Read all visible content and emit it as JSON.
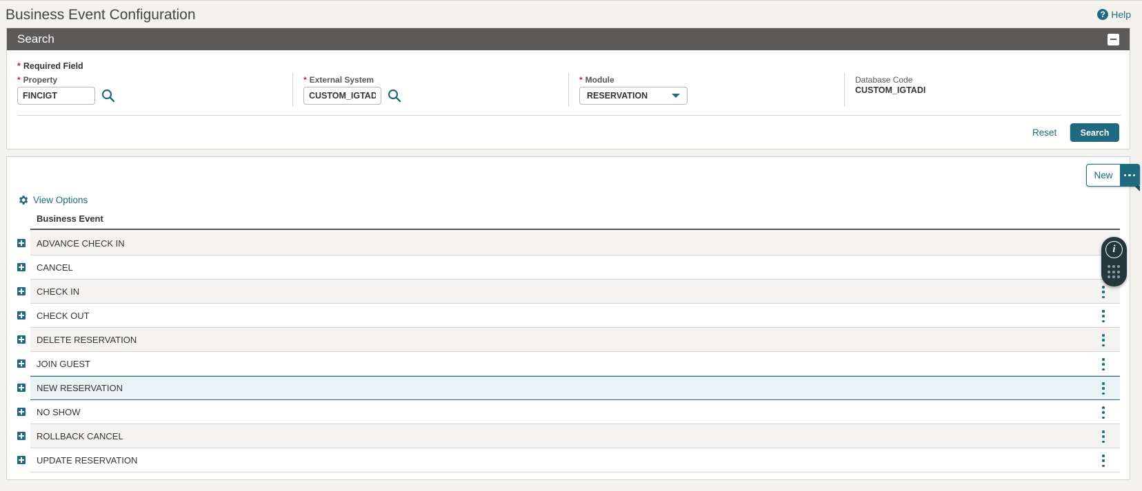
{
  "page": {
    "title": "Business Event Configuration",
    "help_label": "Help"
  },
  "search": {
    "panel_title": "Search",
    "required_note": "Required Field",
    "property": {
      "label": "Property",
      "value": "FINCIGT"
    },
    "external_system": {
      "label": "External System",
      "value": "CUSTOM_IGTADI"
    },
    "module": {
      "label": "Module",
      "value": "RESERVATION"
    },
    "database_code": {
      "label": "Database Code",
      "value": "CUSTOM_IGTADI"
    },
    "reset_label": "Reset",
    "search_label": "Search"
  },
  "results": {
    "new_label": "New",
    "view_options_label": "View Options",
    "column_header": "Business Event",
    "rows": [
      {
        "name": "ADVANCE CHECK IN"
      },
      {
        "name": "CANCEL"
      },
      {
        "name": "CHECK IN"
      },
      {
        "name": "CHECK OUT"
      },
      {
        "name": "DELETE RESERVATION"
      },
      {
        "name": "JOIN GUEST"
      },
      {
        "name": "NEW RESERVATION"
      },
      {
        "name": "NO SHOW"
      },
      {
        "name": "ROLLBACK CANCEL"
      },
      {
        "name": "UPDATE RESERVATION"
      }
    ],
    "selected_row": "NEW RESERVATION"
  },
  "colors": {
    "accent": "#1f6a7e",
    "header_bar": "#5b5a58",
    "required_star": "#c0262d"
  }
}
